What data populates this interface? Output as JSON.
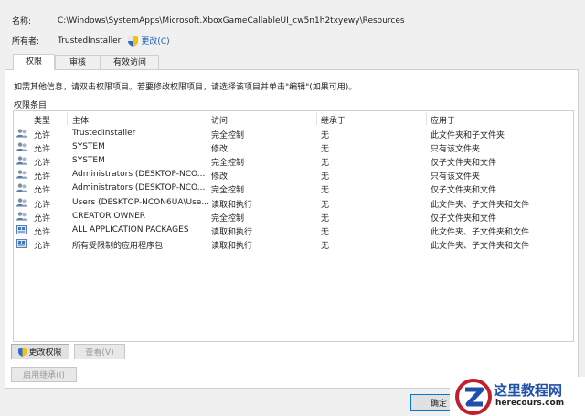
{
  "header": {
    "name_label": "名称:",
    "name_value": "C:\\Windows\\SystemApps\\Microsoft.XboxGameCallableUI_cw5n1h2txyewy\\Resources",
    "owner_label": "所有者:",
    "owner_value": "TrustedInstaller",
    "change_link": "更改(C)"
  },
  "tabs": [
    {
      "label": "权限",
      "active": true
    },
    {
      "label": "审核",
      "active": false
    },
    {
      "label": "有效访问",
      "active": false
    }
  ],
  "hint": "如需其他信息，请双击权限项目。若要修改权限项目，请选择该项目并单击\"编辑\"(如果可用)。",
  "entries_label": "权限条目:",
  "columns": [
    "类型",
    "主体",
    "访问",
    "继承于",
    "应用于"
  ],
  "rows": [
    {
      "type": "允许",
      "principal": "TrustedInstaller",
      "access": "完全控制",
      "inherited": "无",
      "applies": "此文件夹和子文件夹",
      "icon": "users-icon"
    },
    {
      "type": "允许",
      "principal": "SYSTEM",
      "access": "修改",
      "inherited": "无",
      "applies": "只有该文件夹",
      "icon": "users-icon"
    },
    {
      "type": "允许",
      "principal": "SYSTEM",
      "access": "完全控制",
      "inherited": "无",
      "applies": "仅子文件夹和文件",
      "icon": "users-icon"
    },
    {
      "type": "允许",
      "principal": "Administrators (DESKTOP-NCO...",
      "access": "修改",
      "inherited": "无",
      "applies": "只有该文件夹",
      "icon": "users-icon"
    },
    {
      "type": "允许",
      "principal": "Administrators (DESKTOP-NCO...",
      "access": "完全控制",
      "inherited": "无",
      "applies": "仅子文件夹和文件",
      "icon": "users-icon"
    },
    {
      "type": "允许",
      "principal": "Users (DESKTOP-NCON6UA\\Use...",
      "access": "读取和执行",
      "inherited": "无",
      "applies": "此文件夹、子文件夹和文件",
      "icon": "users-icon"
    },
    {
      "type": "允许",
      "principal": "CREATOR OWNER",
      "access": "完全控制",
      "inherited": "无",
      "applies": "仅子文件夹和文件",
      "icon": "users-icon"
    },
    {
      "type": "允许",
      "principal": "ALL APPLICATION PACKAGES",
      "access": "读取和执行",
      "inherited": "无",
      "applies": "此文件夹、子文件夹和文件",
      "icon": "package-icon"
    },
    {
      "type": "允许",
      "principal": "所有受限制的应用程序包",
      "access": "读取和执行",
      "inherited": "无",
      "applies": "此文件夹、子文件夹和文件",
      "icon": "package-icon"
    }
  ],
  "buttons": {
    "change_permissions": "更改权限",
    "view": "查看(V)",
    "enable_inheritance": "启用继承(I)",
    "ok": "确定"
  },
  "watermark": {
    "title": "这里教程网",
    "url": "herecours.com"
  }
}
